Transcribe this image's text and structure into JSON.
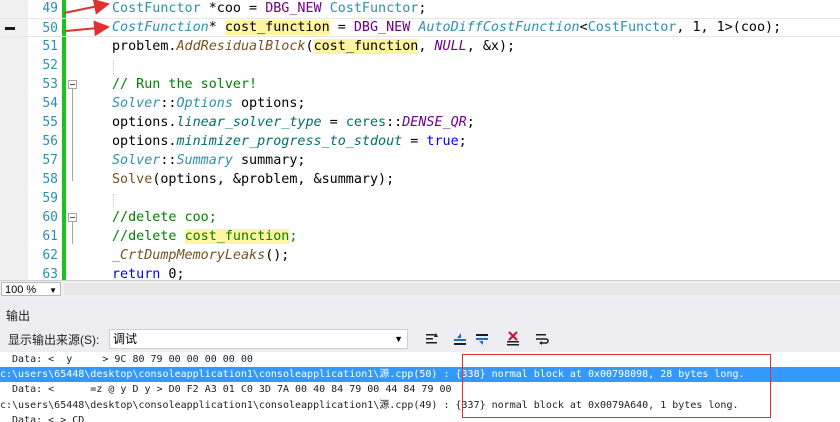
{
  "editor": {
    "lines": [
      {
        "n": "49",
        "code": "CostFunctor *coo = DBG_NEW CostFunctor;"
      },
      {
        "n": "50",
        "code": "CostFunction* cost_function = DBG_NEW AutoDiffCostFunction<CostFunctor, 1, 1>(coo);"
      },
      {
        "n": "51",
        "code": "problem.AddResidualBlock(cost_function, NULL, &x);"
      },
      {
        "n": "52",
        "code": ""
      },
      {
        "n": "53",
        "code": "// Run the solver!"
      },
      {
        "n": "54",
        "code": "Solver::Options options;"
      },
      {
        "n": "55",
        "code": "options.linear_solver_type = ceres::DENSE_QR;"
      },
      {
        "n": "56",
        "code": "options.minimizer_progress_to_stdout = true;"
      },
      {
        "n": "57",
        "code": "Solver::Summary summary;"
      },
      {
        "n": "58",
        "code": "Solve(options, &problem, &summary);"
      },
      {
        "n": "59",
        "code": ""
      },
      {
        "n": "60",
        "code": "//delete coo;"
      },
      {
        "n": "61",
        "code": "//delete cost_function;"
      },
      {
        "n": "62",
        "code": "_CrtDumpMemoryLeaks();"
      },
      {
        "n": "63",
        "code": "return 0;"
      }
    ]
  },
  "zoom": {
    "value": "100 %"
  },
  "output": {
    "title": "输出",
    "source_label": "显示输出来源(S):",
    "source_value": "调试",
    "lines": [
      "  Data: <  y     > 9C 80 79 00 00 00 00 00",
      "c:\\users\\65448\\desktop\\consoleapplication1\\consoleapplication1\\源.cpp(50) : {338} normal block at 0x00798098, 28 bytes long.",
      "  Data: <      =z @ y D y > D0 F2 A3 01 C0 3D 7A 00 40 84 79 00 44 84 79 00",
      "c:\\users\\65448\\desktop\\consoleapplication1\\consoleapplication1\\源.cpp(49) : {337} normal block at 0x0079A640, 1 bytes long.",
      "  Data: < > CD"
    ]
  },
  "colors": {
    "selection": "#3399ff",
    "annotation_red": "#e03131",
    "change_bar": "#19c31c"
  }
}
